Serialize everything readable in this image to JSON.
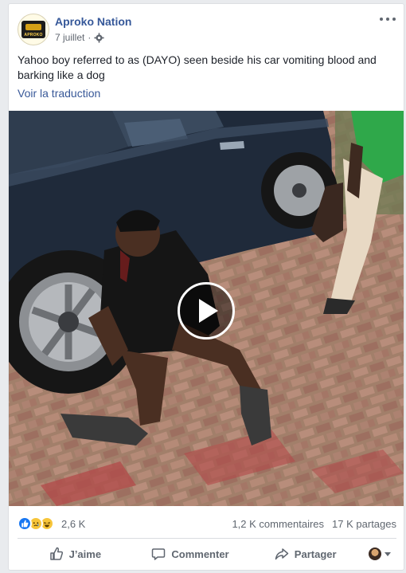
{
  "post": {
    "page_name": "Aproko Nation",
    "avatar_text": "APROKO",
    "date": "7 juillet",
    "date_separator": "·",
    "audience_icon": "gear-icon",
    "text": "Yahoo boy referred to as (DAYO) seen beside his car vomiting blood and barking like a dog",
    "translate_label": "Voir la traduction"
  },
  "video": {
    "play_icon": "play-icon"
  },
  "stats": {
    "reaction_icons": [
      "like-icon",
      "sad-icon",
      "haha-icon"
    ],
    "reaction_count": "2,6 K",
    "comments": "1,2 K commentaires",
    "shares": "17 K partages"
  },
  "actions": {
    "like_label": "J’aime",
    "comment_label": "Commenter",
    "share_label": "Partager"
  },
  "colors": {
    "link": "#385898",
    "page_name": "#365899",
    "like_blue": "#1877f2"
  }
}
